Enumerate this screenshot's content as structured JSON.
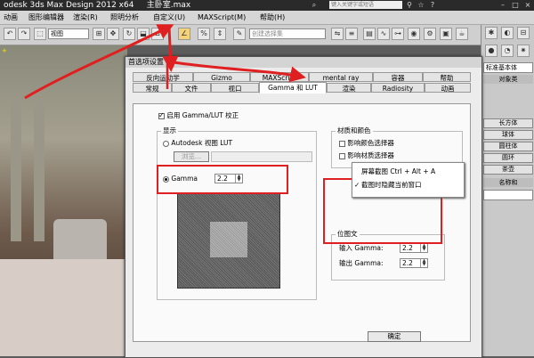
{
  "app": {
    "title": "odesk 3ds Max Design 2012 x64",
    "file": "主卧室.max",
    "search_placeholder": "键入关键字或短语"
  },
  "menu": [
    "动画",
    "图形编辑器",
    "渲染(R)",
    "照明分析",
    "自定义(U)",
    "MAXScript(M)",
    "帮助(H)"
  ],
  "toolbar": {
    "view_dropdown": "视图",
    "selection_set_placeholder": "创建选择集"
  },
  "viewport": {
    "label": "+"
  },
  "command_panel": {
    "section_title": "对象类",
    "dropdown": "标准基本体",
    "buttons": [
      "长方体",
      "球体",
      "圆柱体",
      "圆环",
      "茶壶"
    ],
    "name_color_label": "名称和"
  },
  "dialog": {
    "title": "首选项设置",
    "tabs_row1": [
      "反向运动学",
      "Gizmo",
      "MAXScript",
      "mental ray",
      "容器",
      "帮助"
    ],
    "tabs_row2": [
      "常规",
      "文件",
      "视口",
      "Gamma 和 LUT",
      "渲染",
      "Radiosity",
      "动画"
    ],
    "active_tab": "Gamma 和 LUT",
    "enable_gamma_label": "启用 Gamma/LUT 校正",
    "enable_gamma_checked": true,
    "display_group": "显示",
    "autodesk_lut_label": "Autodesk 视图 LUT",
    "browse_label": "浏览...",
    "gamma_label": "Gamma",
    "gamma_value": "2.2",
    "gamma_selected": true,
    "material_group": "材质和颜色",
    "affect_color_picker": "影响颜色选择器",
    "affect_material_picker": "影响材质选择器",
    "bitmap_group": "位图文",
    "input_gamma_label": "输入 Gamma:",
    "input_gamma_value": "2.2",
    "output_gamma_label": "输出 Gamma:",
    "output_gamma_value": "2.2",
    "ok_label": "确定"
  },
  "popup": {
    "items": [
      "屏幕截图 Ctrl + Alt + A",
      "截图时隐藏当前窗口"
    ],
    "checked_index": 1
  },
  "colors": {
    "annotation_red": "#e02020",
    "title_bar": "#2a2a2a",
    "dialog_bg": "#ececec"
  }
}
